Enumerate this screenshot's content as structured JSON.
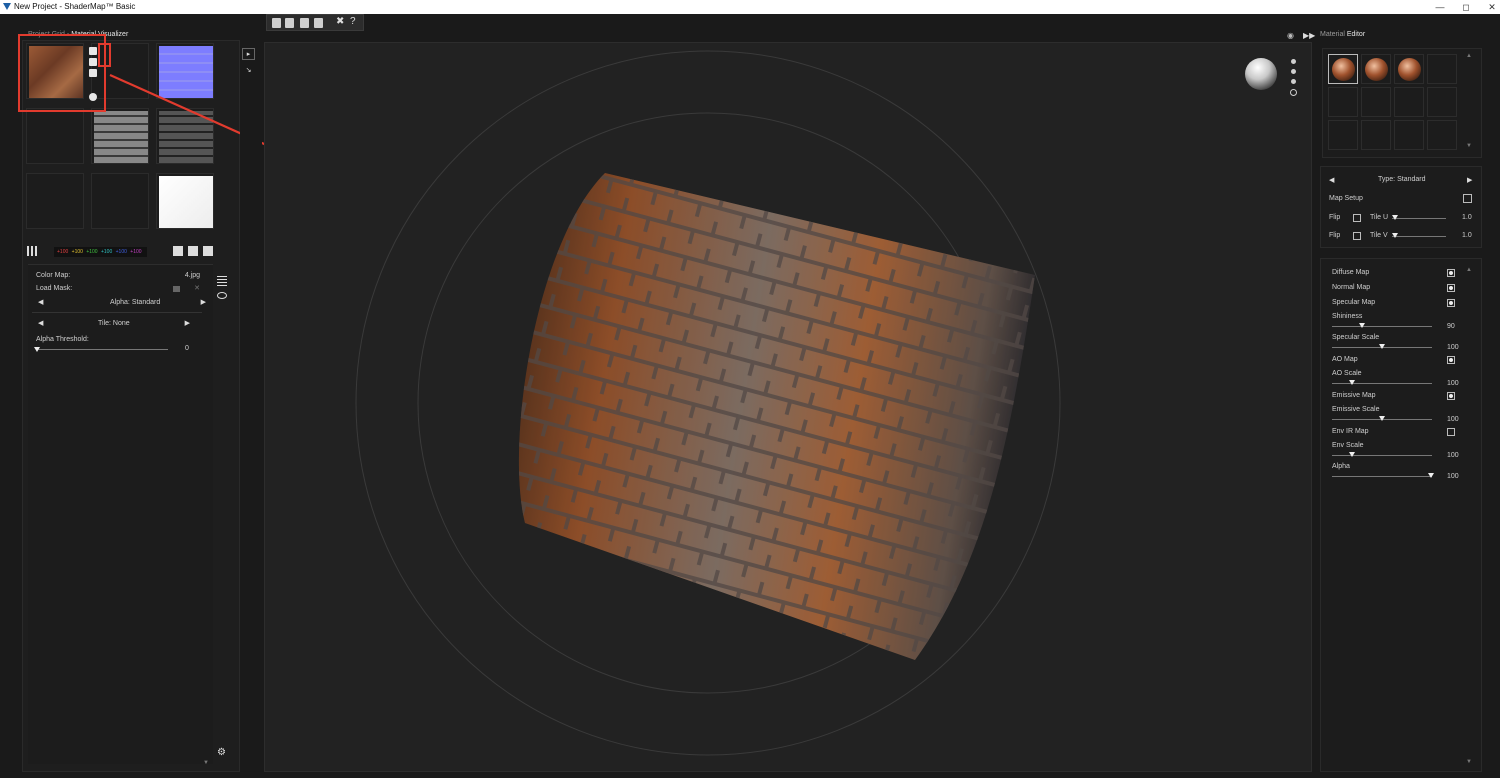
{
  "window": {
    "title": "New Project - ShaderMap™ Basic",
    "min": "—",
    "max": "◻",
    "close": "✕"
  },
  "tabs": {
    "project_grid": "Project Grid",
    "sep": "-",
    "material_visualizer": "Material Visualizer"
  },
  "channels": [
    "+100",
    "+100",
    "+100",
    "+100",
    "+100",
    "+100"
  ],
  "channel_colors": [
    "#e04040",
    "#e0c030",
    "#40c040",
    "#30c0c0",
    "#4060e0",
    "#c040c0"
  ],
  "props": {
    "color_map_label": "Color Map:",
    "color_map_value": "4.jpg",
    "load_mask_label": "Load Mask:",
    "alpha_label": "Alpha:",
    "alpha_value": "Standard",
    "tile_label": "Tile:",
    "tile_value": "None",
    "alpha_threshold_label": "Alpha Threshold:",
    "alpha_threshold_value": "0"
  },
  "right": {
    "header_material": "Material",
    "header_editor": "Editor",
    "type_label": "Type:",
    "type_value": "Standard",
    "map_setup": "Map Setup",
    "flip_label": "Flip",
    "tile_u_label": "Tile U",
    "tile_u_value": "1.0",
    "tile_v_label": "Tile V",
    "tile_v_value": "1.0",
    "maps": [
      {
        "label": "Diffuse Map",
        "checked": true
      },
      {
        "label": "Normal Map",
        "checked": true
      },
      {
        "label": "Specular Map",
        "checked": true
      }
    ],
    "shininess_label": "Shininess",
    "shininess_value": "90",
    "specular_scale_label": "Specular Scale",
    "specular_scale_value": "100",
    "ao_map_label": "AO Map",
    "ao_scale_label": "AO Scale",
    "ao_scale_value": "100",
    "emissive_map_label": "Emissive Map",
    "emissive_scale_label": "Emissive Scale",
    "emissive_scale_value": "100",
    "env_ir_map_label": "Env IR Map",
    "env_scale_label": "Env Scale",
    "env_scale_value": "100",
    "alpha_label": "Alpha",
    "alpha_value": "100"
  }
}
